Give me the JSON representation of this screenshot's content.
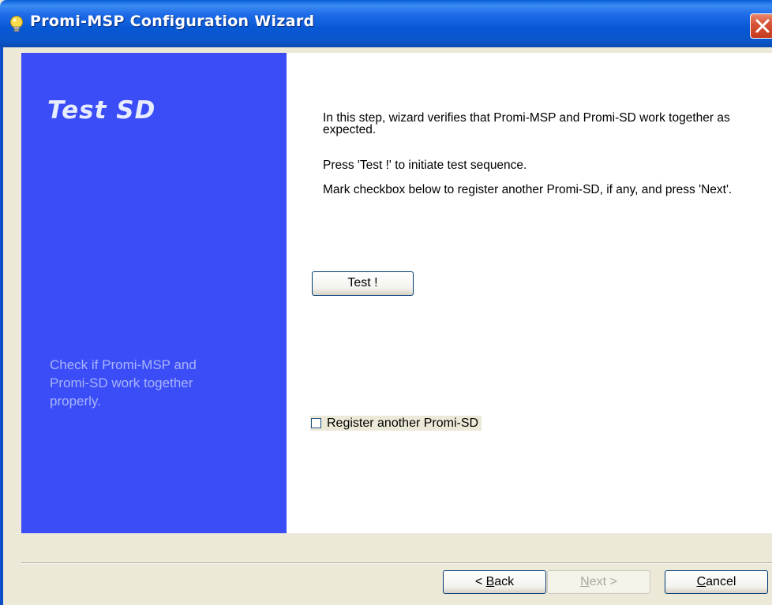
{
  "window": {
    "title": "Promi-MSP Configuration Wizard"
  },
  "icons": {
    "title_icon": "lightbulb-icon",
    "close_icon": "close-icon"
  },
  "colors": {
    "title_bar": "#0758D4",
    "side_panel": "#3A4DF7",
    "dialog_bg": "#ECE9D8",
    "close_button": "#D8553A"
  },
  "side_panel": {
    "heading": "Test SD",
    "description": "Check if Promi-MSP and Promi-SD work together properly."
  },
  "content": {
    "paragraph1": "In this step, wizard verifies that Promi-MSP and Promi-SD work together as expected.",
    "paragraph2": "Press 'Test !' to initiate test sequence.",
    "paragraph3": "Mark checkbox below to register another Promi-SD, if any, and press 'Next'.",
    "test_button_label": "Test !",
    "checkbox_label": "Register another Promi-SD",
    "checkbox_checked": false
  },
  "buttons": {
    "back": {
      "prefix": "< ",
      "accel": "B",
      "rest": "ack"
    },
    "next": {
      "accel": "N",
      "rest": "ext >",
      "enabled": false
    },
    "cancel": {
      "accel": "C",
      "rest": "ancel"
    }
  }
}
